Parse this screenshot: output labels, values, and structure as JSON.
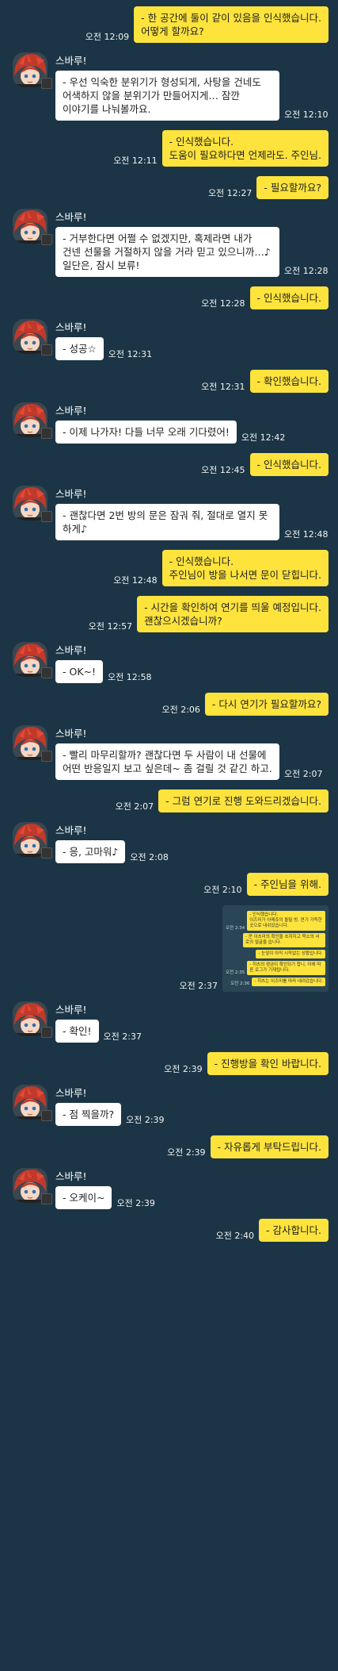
{
  "colors": {
    "background": "#1b3546",
    "user_bubble": "#fde33c",
    "bot_bubble": "#ffffff"
  },
  "bot_name": "스바루!",
  "messages": [
    {
      "from": "me",
      "time": "오전 12:09",
      "text": "- 한 공간에 둘이 같이 있음을 인식했습니다.\n어떻게 할까요?"
    },
    {
      "from": "bot",
      "time": "오전 12:10",
      "text": "- 우선 익숙한 분위기가 형성되게, 사탕을 건네도 어색하지 않을 분위기가 만들어지게… 잠깐 이야기를 나눠볼까요."
    },
    {
      "from": "me",
      "time": "오전 12:11",
      "text": "- 인식했습니다.\n도움이 필요하다면 언제라도. 주인님."
    },
    {
      "from": "me",
      "time": "오전 12:27",
      "text": "- 필요할까요?"
    },
    {
      "from": "bot",
      "time": "오전 12:28",
      "text": "- 거부한다면 어쩔 수 없겠지만, 혹제라면 내가 건넨 선물을 거절하지 않을 거라 믿고 있으니까…♪ 일단은, 잠시 보류!"
    },
    {
      "from": "me",
      "time": "오전 12:28",
      "text": "- 인식했습니다."
    },
    {
      "from": "bot",
      "time": "오전 12:31",
      "text": "- 성공☆"
    },
    {
      "from": "me",
      "time": "오전 12:31",
      "text": "- 확인했습니다."
    },
    {
      "from": "bot",
      "time": "오전 12:42",
      "text": "- 이제 나가자! 다들 너무 오래 기다렸어!"
    },
    {
      "from": "me",
      "time": "오전 12:45",
      "text": "- 인식했습니다."
    },
    {
      "from": "bot",
      "time": "오전 12:48",
      "text": "- 괜찮다면 2번 방의 문은 잠궈 줘, 절대로 열지 못 하게♪"
    },
    {
      "from": "me",
      "time": "오전 12:48",
      "text": "- 인식했습니다.\n주인님이 방을 나서면 문이 닫힙니다."
    },
    {
      "from": "me",
      "time": "오전 12:57",
      "text": "- 시간을 확인하여 연기를 띄울 예정입니다.\n괜찮으시겠습니까?"
    },
    {
      "from": "bot",
      "time": "오전 12:58",
      "text": "- OK~!"
    },
    {
      "from": "me",
      "time": "오전 2:06",
      "text": "- 다시 연기가 필요할까요?"
    },
    {
      "from": "bot",
      "time": "오전 2:07",
      "text": "- 빨리 마무리할까? 괜찮다면 두 사람이 내 선물에 어떤 반응일지 보고 싶은데~ 좀 걸릴 것 같긴 하고."
    },
    {
      "from": "me",
      "time": "오전 2:07",
      "text": "- 그럼 연기로 진행 도와드리겠습니다."
    },
    {
      "from": "bot",
      "time": "오전 2:08",
      "text": "- 응, 고마워♪"
    },
    {
      "from": "me",
      "time": "오전 2:10",
      "text": "- 주인님을 위해."
    },
    {
      "from": "image",
      "time": "오전 2:37",
      "mini": [
        {
          "time": "오전 2:34",
          "text": "- 인식했습니다.\n이즈미가 아메쥬의 돌릴 방, 연기 가득한 곳으로 내쉬었습니다."
        },
        {
          "time": "",
          "text": "- 쿤 이츠미의 확인을 초하지고 묵소의 서로의 얼굴을 습니다."
        },
        {
          "time": "",
          "text": "- 눈앞이 아직 시작없는 상황입니다."
        },
        {
          "time": "오전 2:35",
          "text": "- 히츠의 생금이 확인되기 합니, 이에 따른 로그가 기재됩니다."
        },
        {
          "time": "오전 2:36",
          "text": "- 히츠는 이즈미를 따라 내려갔습니다."
        }
      ]
    },
    {
      "from": "bot",
      "time": "오전 2:37",
      "text": "- 확인!"
    },
    {
      "from": "me",
      "time": "오전 2:39",
      "text": "- 진행방을 확인 바랍니다."
    },
    {
      "from": "bot",
      "time": "오전 2:39",
      "text": "- 점 찍을까?"
    },
    {
      "from": "me",
      "time": "오전 2:39",
      "text": "- 자유롭게 부탁드립니다."
    },
    {
      "from": "bot",
      "time": "오전 2:39",
      "text": "- 오케이~"
    },
    {
      "from": "me",
      "time": "오전 2:40",
      "text": "- 감사합니다."
    }
  ]
}
